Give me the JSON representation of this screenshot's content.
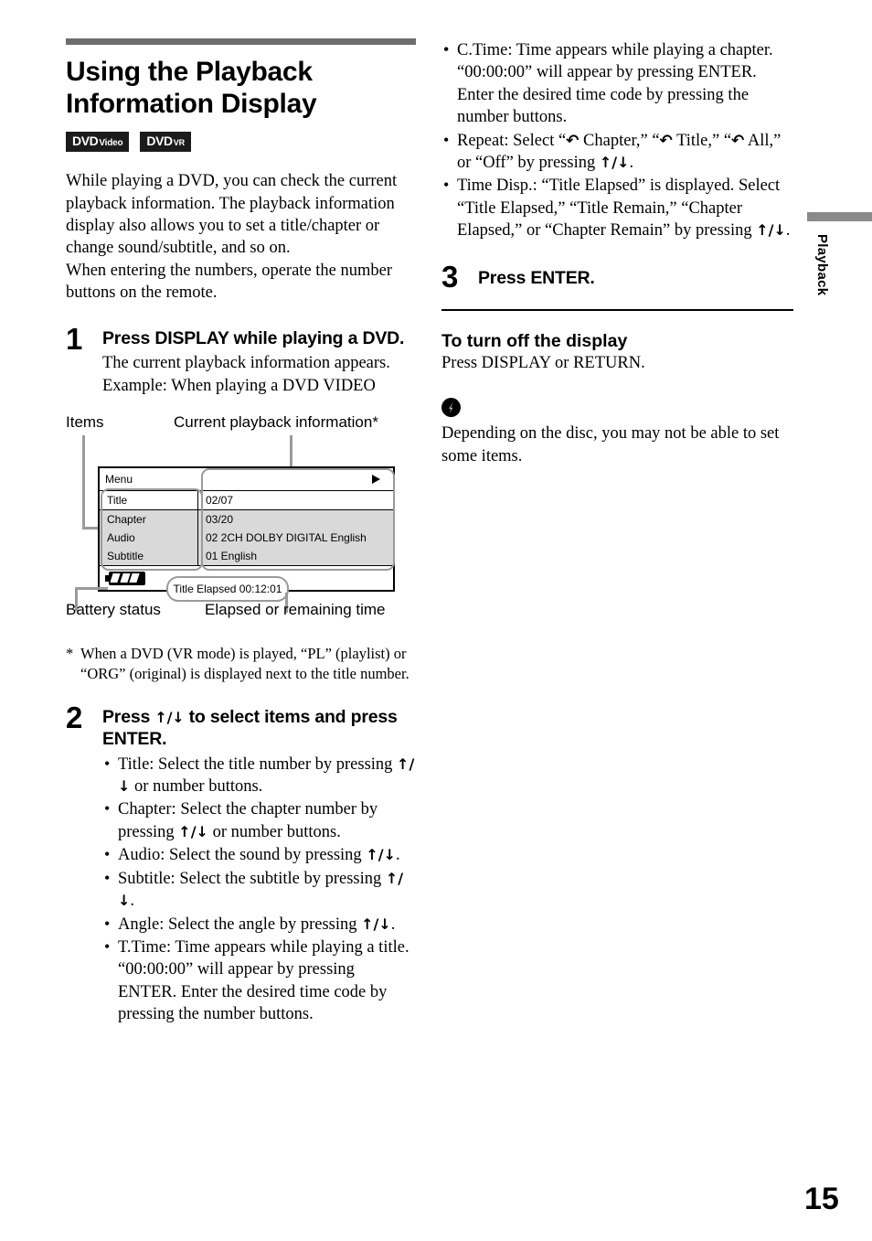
{
  "header": {
    "title": "Using the Playback Information Display",
    "badges": [
      {
        "main": "DVD",
        "sub": "Video"
      },
      {
        "main": "DVD",
        "sub": "VR"
      }
    ]
  },
  "intro": {
    "lines": [
      "While playing a DVD, you can check the current playback information. The playback information display also allows you to set a title/chapter or change sound/subtitle, and so on.",
      "When entering the numbers, operate the number buttons on the remote."
    ]
  },
  "steps": {
    "one": {
      "number": "1",
      "heading": "Press DISPLAY while playing a DVD.",
      "lines": [
        "The current playback information appears.",
        "Example: When playing a DVD VIDEO"
      ]
    },
    "two": {
      "number": "2",
      "heading_pre": "Press ",
      "heading_arrows": "↑/↓",
      "heading_post": " to select items and press ENTER.",
      "bullets": [
        {
          "pre": "Title: Select the title number by pressing ",
          "arrows": "↑/↓",
          "post": " or number buttons."
        },
        {
          "pre": "Chapter: Select the chapter number by pressing ",
          "arrows": "↑/↓",
          "post": " or number buttons."
        },
        {
          "pre": "Audio: Select the sound by pressing ",
          "arrows": "↑/↓",
          "post": "."
        },
        {
          "pre": "Subtitle: Select the subtitle by pressing ",
          "arrows": "↑/↓",
          "post": "."
        },
        {
          "pre": "Angle: Select the angle by pressing ",
          "arrows": "↑/↓",
          "post": "."
        },
        {
          "pre": "T.Time: Time appears while playing a title. “00:00:00” will appear by pressing ENTER. Enter the desired time code by pressing the number buttons.",
          "arrows": "",
          "post": ""
        },
        {
          "pre": "C.Time: Time appears while playing a chapter. “00:00:00” will appear by pressing ENTER. Enter the desired time code by pressing the number buttons.",
          "arrows": "",
          "post": ""
        }
      ],
      "repeat_bullet": {
        "pre": "Repeat: Select “",
        "loop": "↶",
        "mid1": " Chapter,” “",
        "mid2": " Title,” “",
        "mid3": " All,” or “Off” by pressing ",
        "arrows": "↑/↓",
        "post": "."
      },
      "timedisp_bullet": {
        "pre": "Time Disp.: “Title Elapsed” is displayed. Select “Title Elapsed,” “Title Remain,” “Chapter Elapsed,” or “Chapter Remain” by pressing ",
        "arrows": "↑/↓",
        "post": "."
      }
    },
    "three": {
      "number": "3",
      "heading": "Press ENTER."
    }
  },
  "footnote": {
    "star": "*",
    "text": "When a DVD (VR mode) is played, “PL” (playlist) or “ORG” (original) is displayed next to the title number."
  },
  "diagram": {
    "label_items": "Items",
    "label_current": "Current playback information*",
    "label_battery": "Battery status",
    "label_time": "Elapsed or remaining time",
    "osd": {
      "menu_label": "Menu",
      "rows": [
        {
          "key": "Title",
          "value": "02/07"
        },
        {
          "key": "Chapter",
          "value": "03/20"
        },
        {
          "key": "Audio",
          "value": "02 2CH DOLBY DIGITAL English"
        },
        {
          "key": "Subtitle",
          "value": "01 English"
        }
      ],
      "time_bubble": "Title Elapsed 00:12:01"
    }
  },
  "turn_off": {
    "heading": "To turn off the display",
    "text": "Press DISPLAY or RETURN."
  },
  "note": {
    "text": "Depending on the disc, you may not be able to set some items."
  },
  "side_tab": {
    "label": "Playback"
  },
  "page_number": "15",
  "colors": {
    "rule_gray": "#6d6d6d",
    "callout_gray": "#9a9a9a",
    "row_gray": "#d9d9d9",
    "tab_gray": "#8a8a8a",
    "ink": "#000000"
  }
}
